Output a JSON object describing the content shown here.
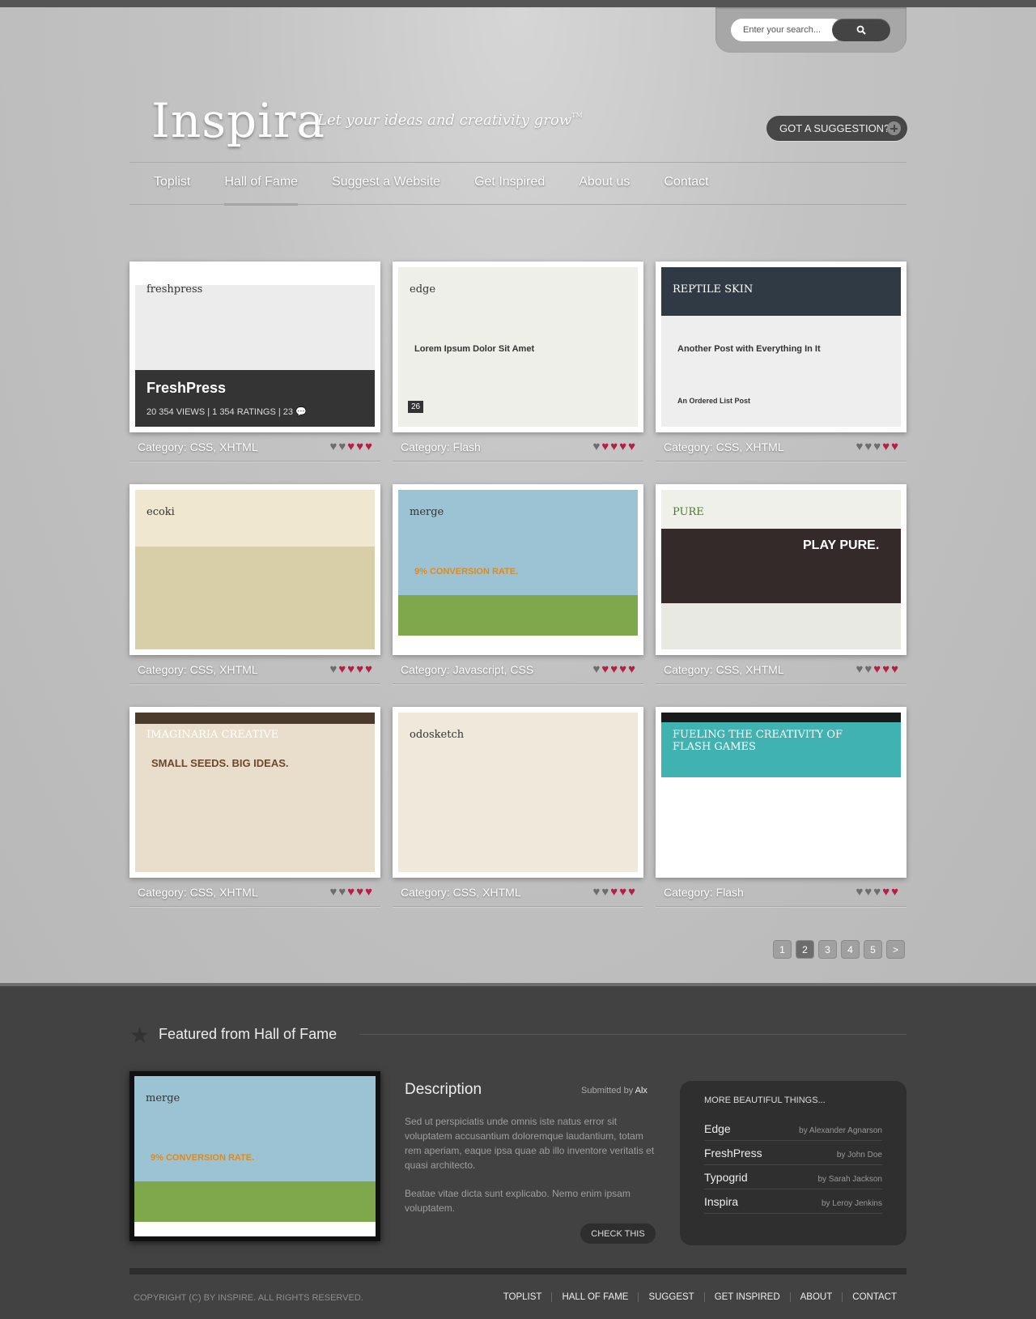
{
  "header": {
    "logo": "Inspira",
    "tagline": "Let your ideas and creativity grow",
    "tm": "TM",
    "search_placeholder": "Enter your search...",
    "suggestion_button": "GOT A SUGGESTION?"
  },
  "nav": [
    "Toplist",
    "Hall of Fame",
    "Suggest a Website",
    "Get Inspired",
    "About us",
    "Contact"
  ],
  "nav_active": "Hall of Fame",
  "cards": [
    {
      "category": "Category: CSS, XHTML",
      "rating": 3,
      "shot": "freshpress",
      "site_name": "freshpress",
      "overlay": {
        "title": "FreshPress",
        "views": "20 354",
        "views_label": "VIEWS",
        "ratings": "1 354",
        "ratings_label": "RATINGS",
        "comments": "23"
      }
    },
    {
      "category": "Category: Flash",
      "rating": 4,
      "shot": "edge",
      "site_name": "edge",
      "headline": "Lorem Ipsum Dolor Sit Amet",
      "date": "26"
    },
    {
      "category": "Category: CSS, XHTML",
      "rating": 2,
      "shot": "reptile",
      "site_name": "REPTILE SKIN",
      "headline": "Another Post with Everything In It",
      "headline2": "An Ordered List Post"
    },
    {
      "category": "Category: CSS, XHTML",
      "rating": 4,
      "shot": "ecoki",
      "site_name": "ecoki"
    },
    {
      "category": "Category: Javascript, CSS",
      "rating": 4,
      "shot": "merge",
      "site_name": "merge",
      "headline": "9% CONVERSION RATE."
    },
    {
      "category": "Category: CSS, XHTML",
      "rating": 3,
      "shot": "pure",
      "site_name": "PURE",
      "headline": "PLAY PURE."
    },
    {
      "category": "Category: CSS, XHTML",
      "rating": 3,
      "shot": "imaginaria",
      "site_name": "IMAGINARIA CREATIVE",
      "headline": "SMALL SEEDS. BIG IDEAS."
    },
    {
      "category": "Category: CSS, XHTML",
      "rating": 3,
      "shot": "odosketch",
      "site_name": "odosketch"
    },
    {
      "category": "Category: Flash",
      "rating": 2,
      "shot": "fueling",
      "site_name": "FUELING THE CREATIVITY OF FLASH GAMES"
    }
  ],
  "pagination": [
    "1",
    "2",
    "3",
    "4",
    "5",
    ">"
  ],
  "pagination_active": "2",
  "featured": {
    "heading": "Featured from Hall of Fame",
    "description_title": "Description",
    "submitted_label": "Submitted by",
    "submitted_by": "Alx",
    "paragraph1": "Sed ut perspiciatis unde omnis iste natus error sit voluptatem accusantium doloremque laudantium, totam rem aperiam, eaque ipsa quae ab illo inventore veritatis et quasi architecto.",
    "paragraph2": "Beatae vitae dicta sunt explicabo. Nemo enim ipsam voluptatem.",
    "check_button": "CHECK THIS",
    "more_title": "MORE BEAUTIFUL THINGS...",
    "more_items": [
      {
        "name": "Edge",
        "author": "by Alexander Agnarson"
      },
      {
        "name": "FreshPress",
        "author": "by John Doe"
      },
      {
        "name": "Typogrid",
        "author": "by Sarah Jackson"
      },
      {
        "name": "Inspira",
        "author": "by Leroy Jenkins"
      }
    ]
  },
  "footer": {
    "copyright": "COPYRIGHT (C) BY INSPIRE. ALL RIGHTS RESERVED.",
    "links": [
      "TOPLIST",
      "HALL OF FAME",
      "SUGGEST",
      "GET INSPIRED",
      "ABOUT",
      "CONTACT"
    ]
  },
  "colors": {
    "heart_on": "#b51e45",
    "heart_off": "#6d6d6d",
    "footer_bg": "#424242"
  }
}
